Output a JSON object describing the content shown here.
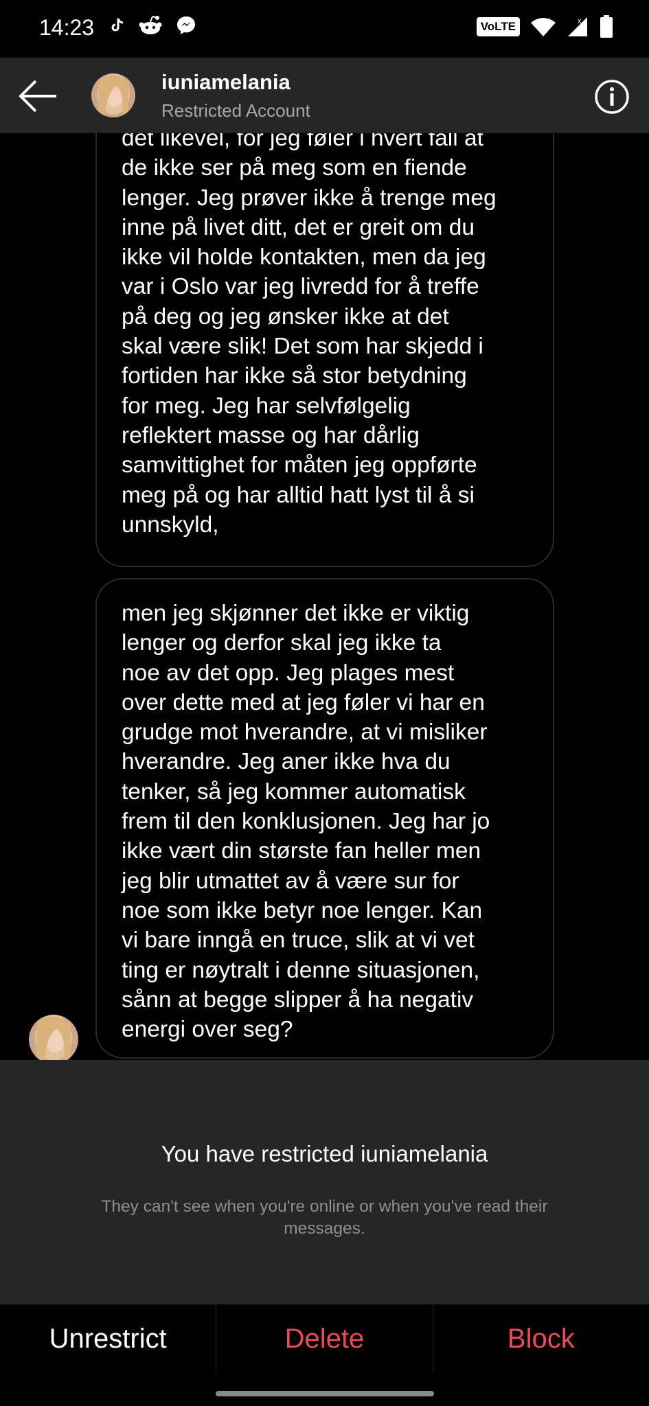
{
  "status_bar": {
    "time": "14:23",
    "volte": "VoLTE",
    "left_icons": [
      "tiktok-icon",
      "reddit-icon",
      "messenger-icon"
    ],
    "right_icons": [
      "volte-icon",
      "wifi-icon",
      "signal-icon",
      "battery-icon"
    ]
  },
  "header": {
    "username": "iuniamelania",
    "subtitle": "Restricted Account",
    "icons": [
      "back-arrow-icon",
      "avatar",
      "info-icon"
    ]
  },
  "messages": [
    {
      "text": "det likevel, for jeg føler i hvert fall at\nde ikke ser på meg som en fiende\nlenger. Jeg prøver ikke å trenge meg\ninne på livet ditt, det er greit om du\nikke vil holde kontakten, men da jeg\nvar i Oslo var jeg livredd for å treffe\npå deg og jeg ønsker ikke at det\nskal være slik! Det som har skjedd i\nfortiden har ikke så stor betydning\nfor meg. Jeg har selvfølgelig\nreflektert masse og har dårlig\nsamvittighet for måten jeg oppførte\nmeg på og har alltid hatt lyst til å si\nunnskyld,"
    },
    {
      "text": "men jeg skjønner det ikke er viktig\nlenger og derfor skal jeg ikke ta\nnoe av det opp. Jeg plages mest\nover dette med at jeg føler vi har en\ngrudge mot hverandre, at vi misliker\nhverandre. Jeg aner ikke hva du\ntenker, så jeg kommer automatisk\nfrem til den konklusjonen. Jeg har jo\nikke vært din største fan heller men\njeg blir utmattet av å være sur for\nnoe som ikke betyr noe lenger. Kan\nvi bare inngå en truce, slik at vi vet\nting er nøytralt i denne situasjonen,\nsånn at begge slipper å ha negativ\nenergi over seg?"
    }
  ],
  "restricted_panel": {
    "title": "You have restricted iuniamelania",
    "description": "They can't see when you're online or when you've read their messages."
  },
  "actions": {
    "unrestrict": "Unrestrict",
    "delete": "Delete",
    "block": "Block"
  },
  "colors": {
    "header_bg": "#262626",
    "panel_bg": "#262626",
    "danger": "#ed4956",
    "muted": "#8e8e8e"
  }
}
